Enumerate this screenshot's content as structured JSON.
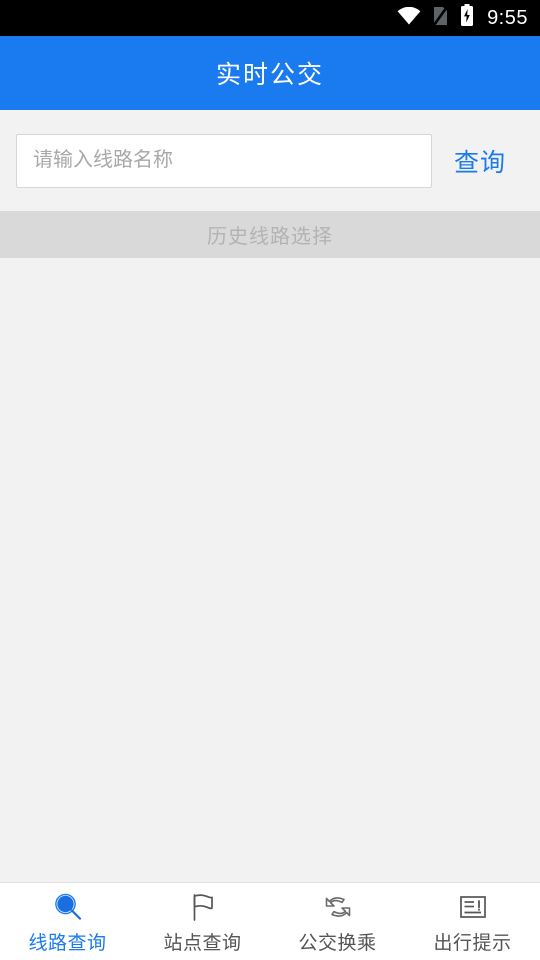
{
  "statusbar": {
    "time": "9:55",
    "icons": [
      "wifi-icon",
      "no-sim-icon",
      "battery-charging-icon"
    ]
  },
  "header": {
    "title": "实时公交"
  },
  "search": {
    "placeholder": "请输入线路名称",
    "value": "",
    "button_label": "查询"
  },
  "history": {
    "label": "历史线路选择"
  },
  "content": {
    "items": []
  },
  "bottomnav": {
    "active_index": 0,
    "items": [
      {
        "label": "线路查询",
        "icon": "magnifier-icon"
      },
      {
        "label": "站点查询",
        "icon": "flag-icon"
      },
      {
        "label": "公交换乘",
        "icon": "swap-arrows-icon"
      },
      {
        "label": "出行提示",
        "icon": "notice-document-icon"
      }
    ]
  },
  "colors": {
    "accent": "#1a7bf0",
    "statusbar_bg": "#000000",
    "page_bg": "#f2f2f2",
    "history_bg": "#d9d9d9",
    "nav_text": "#555555"
  }
}
